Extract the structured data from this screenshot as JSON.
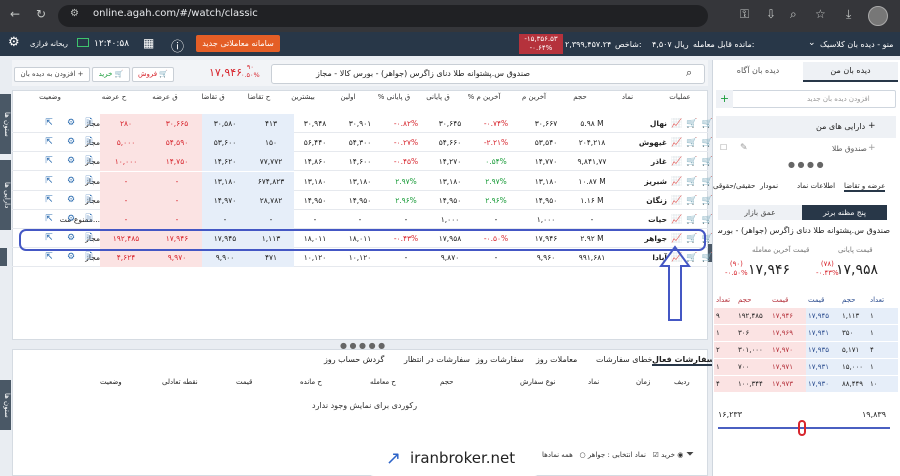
{
  "browser": {
    "url": "online.agah.com/#/watch/classic"
  },
  "app": {
    "menu_label": "منو - دیده بان کلاسیک",
    "remain_label": "مانده قابل معامله:",
    "remain_value": "۴,۵۰۷ ریال",
    "index_label": "شاخص:",
    "index_value": "۲,۳۹۹,۴۵۷.۲۴",
    "index_change": "-۱۵,۳۵۶.۵۳",
    "index_pct": "-۰.۶۴%",
    "new_system_label": "سامانه معاملاتی جدید",
    "time": "۱۲:۴۰:۵۸",
    "cloud_label": "ریحانه فرازی"
  },
  "toolbar": {
    "add_watch_label": "افزودن به دیده بان",
    "buy_label": "خرید",
    "sell_label": "فروش",
    "price": "۱۷,۹۴۶",
    "change": "۹۰",
    "change_pct": "۰.۵۰%",
    "search_text": "صندوق س.پشتوانه طلا دنای زاگرس (جواهر) - بورس کالا - مجاز"
  },
  "watch_table": {
    "headers": [
      "عملیات",
      "نماد",
      "حجم",
      "آخرین م",
      "% آخرین م",
      "ق پایانی",
      "% ق پایانی",
      "اولین",
      "بیشترین",
      "ح تقاضا",
      "ق تقاضا",
      "ق عرضه",
      "ح عرضه",
      "وضعیت"
    ],
    "rows": [
      {
        "symbol": "نهال",
        "volume": "۵.۹۸ M",
        "last": "۳۰,۶۶۷",
        "last_pct": "-۰.۷۴%",
        "close": "۳۰,۶۴۵",
        "close_pct": "-۰.۸۲%",
        "first": "۳۰,۹۰۱",
        "high": "۳۰,۹۴۸",
        "bid_vol": "۴۱۳",
        "bid": "۳۰,۵۸۰",
        "ask": "۳۰,۶۶۵",
        "ask_vol": "۲۸۰",
        "status": "مجاز"
      },
      {
        "symbol": "غیهوش",
        "volume": "۲۰۴,۲۱۸",
        "last": "۵۳,۵۴۰",
        "last_pct": "-۲.۲۱%",
        "close": "۵۴,۶۶۰",
        "close_pct": "-۰.۲۷%",
        "first": "۵۴,۳۰۰",
        "high": "۵۶,۴۴۰",
        "bid_vol": "۱۵۰",
        "bid": "۵۳,۶۰۰",
        "ask": "۵۴,۵۹۰",
        "ask_vol": "۵,۰۰۰",
        "status": "مجاز"
      },
      {
        "symbol": "غاذر",
        "volume": "۹,۸۴۱,۷۷",
        "last": "۱۴,۷۷۰",
        "last_pct": "۰.۵۴%",
        "close": "۱۴,۲۷۰",
        "close_pct": "-۰.۴۵%",
        "first": "۱۴,۶۰۰",
        "high": "۱۴,۸۶۰",
        "bid_vol": "۷۷,۷۷۲",
        "bid": "۱۴,۶۲۰",
        "ask": "۱۴,۷۵۰",
        "ask_vol": "۱۰,۰۰۰",
        "status": "مجاز"
      },
      {
        "symbol": "شبریز",
        "volume": "۱۰.۸۷ M",
        "last": "۱۳,۱۸۰",
        "last_pct": "۲.۹۷%",
        "close": "۱۳,۱۸۰",
        "close_pct": "۲.۹۷%",
        "first": "۱۳,۱۸۰",
        "high": "۱۳,۱۸۰",
        "bid_vol": "۶۷۴,۸۲۳",
        "bid": "۱۳,۱۸۰",
        "ask": "-",
        "ask_vol": "-",
        "status": "مجاز"
      },
      {
        "symbol": "زنگان",
        "volume": "۱.۱۶ M",
        "last": "۱۴,۹۵۰",
        "last_pct": "۲.۹۶%",
        "close": "۱۴,۹۵۰",
        "close_pct": "۲.۹۶%",
        "first": "۱۴,۹۵۰",
        "high": "۱۴,۹۵۰",
        "bid_vol": "۲۸,۷۸۲",
        "bid": "۱۴,۹۷۰",
        "ask": "-",
        "ask_vol": "-",
        "status": "مجاز"
      },
      {
        "symbol": "حیات",
        "volume": "-",
        "last": "۱,۰۰۰",
        "last_pct": "-",
        "close": "۱,۰۰۰",
        "close_pct": "-",
        "first": "-",
        "high": "-",
        "bid_vol": "-",
        "bid": "-",
        "ask": "-",
        "ask_vol": "-",
        "status": "ممنوع-مت..."
      },
      {
        "symbol": "جواهر",
        "volume": "۲.۹۲ M",
        "last": "۱۷,۹۴۶",
        "last_pct": "-۰.۵۰%",
        "close": "۱۷,۹۵۸",
        "close_pct": "-۰.۴۳%",
        "first": "۱۸,۰۱۱",
        "high": "۱۸,۰۱۱",
        "bid_vol": "۱,۱۱۳",
        "bid": "۱۷,۹۴۵",
        "ask": "۱۷,۹۴۶",
        "ask_vol": "۱۹۲,۴۸۵",
        "status": "مجاز"
      },
      {
        "symbol": "آبادا",
        "volume": "۹۹۱,۶۸۱",
        "last": "۹,۹۶۰",
        "last_pct": "-",
        "close": "۹,۸۷۰",
        "close_pct": "-",
        "first": "۱۰,۱۲۰",
        "high": "۱۰,۱۲۰",
        "bid_vol": "۴۷۱",
        "bid": "۹,۹۰۰",
        "ask": "۹,۹۷۰",
        "ask_vol": "۴,۶۲۴",
        "status": "مجاز"
      }
    ]
  },
  "right_panel": {
    "tab_watch": "دیده بان من",
    "tab_agah": "دیده بان آگاه",
    "add_placeholder": "افزودن دیده بان جدید",
    "my_assets": "دارایی های من",
    "gold_fund": "صندوق طلا",
    "tabs": [
      "عرضه و تقاضا",
      "اطلاعات نماد",
      "نمودار",
      "حقیقی/حقوقی"
    ],
    "depth_tab_active": "پنج مظنه برتر",
    "depth_tab": "عمق بازار",
    "symbol_full": "صندوق س.پشتوانه طلا دنای زاگرس (جواهر) - بورس ک...",
    "close_label": "قیمت پایانی",
    "close_value": "۱۷,۹۵۸",
    "close_change": "(۷۸)",
    "close_pct": "-۰.۴۳%",
    "last_label": "قیمت آخرین معامله",
    "last_value": "۱۷,۹۴۶",
    "last_change": "(۹۰)",
    "last_pct": "-۰.۵۰%",
    "depth_headers": [
      "تعداد",
      "حجم",
      "قیمت",
      "قیمت",
      "حجم",
      "تعداد"
    ],
    "depth_rows": [
      {
        "bid_count": "۱",
        "bid_vol": "۱,۱۱۳",
        "bid_price": "۱۷,۹۴۵",
        "ask_price": "۱۷,۹۴۶",
        "ask_vol": "۱۹۲,۴۸۵",
        "ask_count": "۹"
      },
      {
        "bid_count": "۱",
        "bid_vol": "۳۵۰",
        "bid_price": "۱۷,۹۴۱",
        "ask_price": "۱۷,۹۶۹",
        "ask_vol": "۳۰۶",
        "ask_count": "۱"
      },
      {
        "bid_count": "۴",
        "bid_vol": "۵,۱۷۱",
        "bid_price": "۱۷,۹۳۵",
        "ask_price": "۱۷,۹۷۰",
        "ask_vol": "۳۰۱,۰۰۰",
        "ask_count": "۲"
      },
      {
        "bid_count": "۱",
        "bid_vol": "۱۵,۰۰۰",
        "bid_price": "۱۷,۹۳۱",
        "ask_price": "۱۷,۹۷۱",
        "ask_vol": "۷۰۰",
        "ask_count": "۱"
      },
      {
        "bid_count": "۱۰",
        "bid_vol": "۸۸,۴۴۹",
        "bid_price": "۱۷,۹۳۰",
        "ask_price": "۱۷,۹۷۳",
        "ask_vol": "۱۰۰,۳۴۴",
        "ask_count": "۴"
      }
    ],
    "range_low": "۱۶,۲۳۳",
    "range_high": "۱۹,۸۳۹"
  },
  "bottom": {
    "tabs": [
      "سفارشات فعال",
      "خطای سفارشات",
      "معاملات روز",
      "سفارشات روز",
      "سفارشات در انتظار",
      "گردش حساب روز"
    ],
    "headers": [
      "ردیف",
      "زمان",
      "نماد",
      "نوع سفارش",
      "حجم",
      "ح معامله",
      "ح مانده",
      "قیمت",
      "نقطه تعادلی",
      "وضعیت"
    ],
    "empty": "رکوردی برای نمایش وجود ندارد",
    "filter_all": "همه نمادها",
    "filter_selected": "نماد انتخابی : جواهر",
    "filter_buy": "خرید",
    "side_columns": "ستون ها",
    "side_assets": "دارایی ها",
    "side_columns2": "ستون ها",
    "side_basket": "دسته"
  },
  "watermark": "iranbroker.net",
  "colors": {
    "accent": "#283748",
    "buy": "#1a9c3a",
    "sell": "#d7262e",
    "highlight": "#4457c4",
    "orange": "#e45e26"
  }
}
